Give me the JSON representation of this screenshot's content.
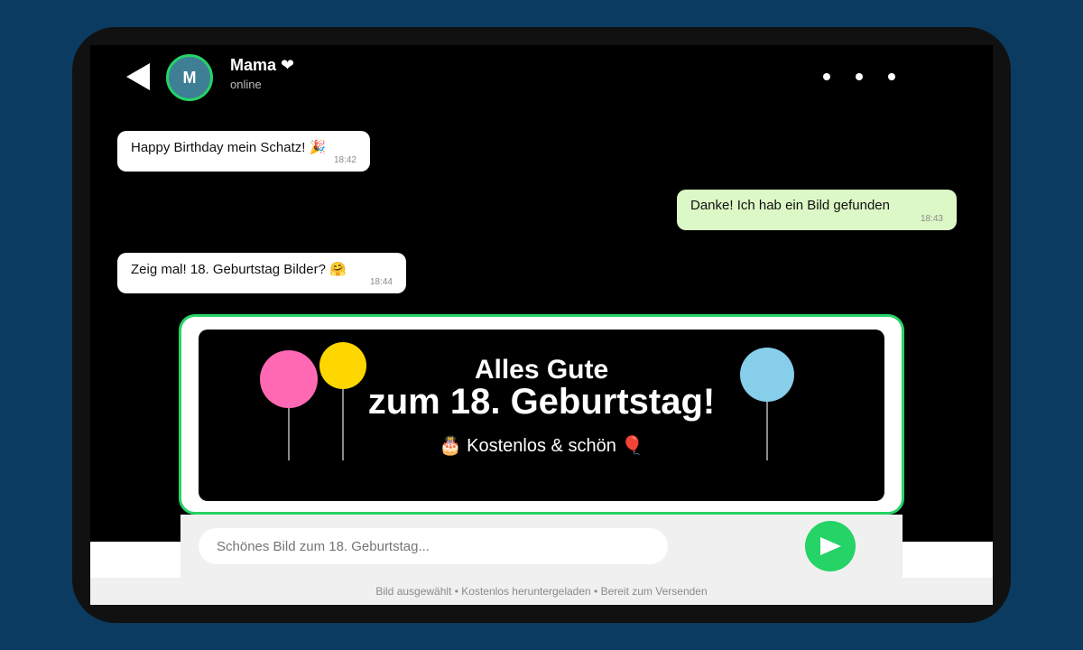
{
  "header": {
    "avatar_initial": "M",
    "contact_name": "Mama ❤",
    "contact_status": "online",
    "back_icon": "back-arrow-icon",
    "menu_icon": "more-dots-icon"
  },
  "messages": [
    {
      "direction": "incoming",
      "text": "Happy Birthday mein Schatz! 🎉",
      "time": "18:42"
    },
    {
      "direction": "outgoing",
      "text": "Danke! Ich hab ein Bild gefunden",
      "time": "18:43"
    },
    {
      "direction": "incoming",
      "text": "Zeig mal! 18. Geburtstag Bilder? 🤗",
      "time": "18:44"
    }
  ],
  "image_card": {
    "line1": "Alles Gute",
    "line2": "zum 18. Geburtstag!",
    "line3": "🎂 Kostenlos & schön 🎈",
    "balloon_colors": [
      "#ff69b4",
      "#ffd700",
      "#87ceeb"
    ]
  },
  "compose": {
    "placeholder": "Schönes Bild zum 18. Geburtstag...",
    "send_icon": "send-arrow-icon"
  },
  "status_bar": "Bild ausgewählt • Kostenlos heruntergeladen • Bereit zum Versenden",
  "colors": {
    "page_bg": "#0b3b60",
    "accent": "#25d366",
    "outgoing_bubble": "#dcf8c6",
    "incoming_bubble": "#ffffff"
  }
}
